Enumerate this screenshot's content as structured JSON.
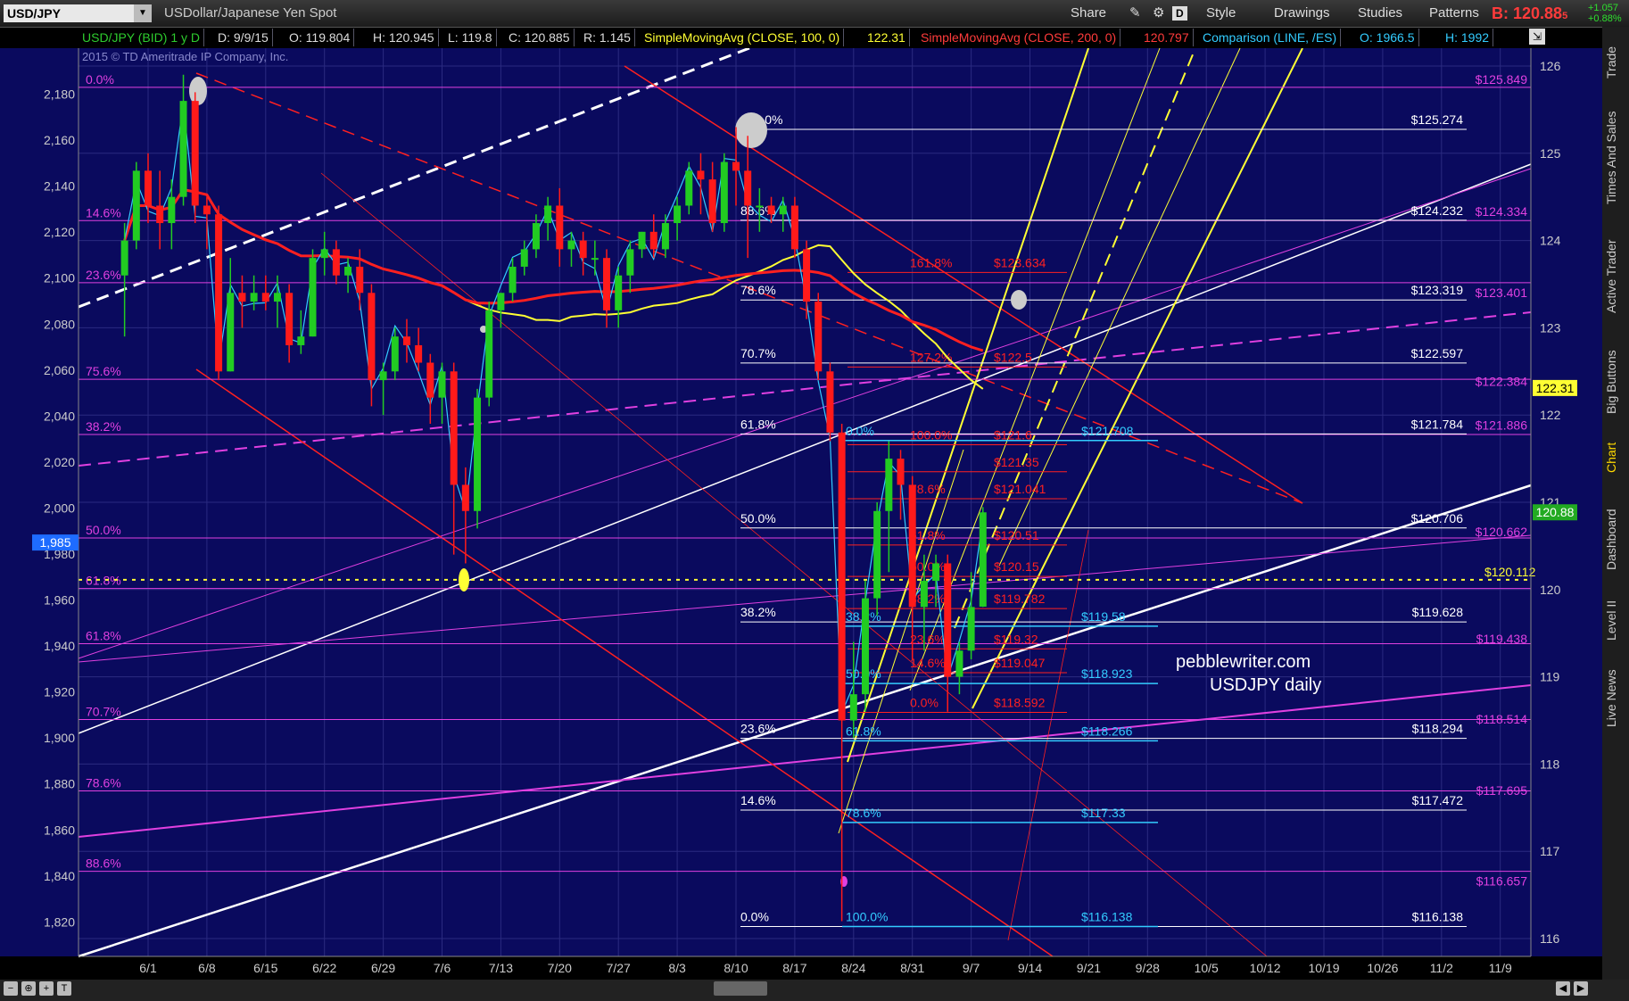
{
  "toolbar": {
    "symbol": "USD/JPY",
    "description": "USDollar/Japanese Yen Spot",
    "share": "Share",
    "style": "Style",
    "drawings": "Drawings",
    "studies": "Studies",
    "patterns": "Patterns",
    "d_box": "D",
    "bid": "B: 120.88",
    "bid_sub": "5",
    "change_up": "+1.057",
    "change_pct": "+0.88%"
  },
  "info_bar": {
    "symbol": "USD/JPY (BID) 1 y D",
    "date": "D: 9/9/15",
    "open": "O: 119.804",
    "high": "H: 120.945",
    "low": "L: 119.8",
    "close": "C: 120.885",
    "range": "R: 1.145",
    "sma100_label": "SimpleMovingAvg (CLOSE, 100, 0)",
    "sma100_value": "122.31",
    "sma200_label": "SimpleMovingAvg (CLOSE, 200, 0)",
    "sma200_value": "120.797",
    "comp_label": "Comparison (LINE, /ES)",
    "comp_open": "O: 1966.5",
    "comp_high": "H: 1992"
  },
  "side_tabs": [
    "Trade",
    "Times And Sales",
    "Active Trader",
    "Big Buttons",
    "Chart",
    "Dashboard",
    "Level II",
    "Live News"
  ],
  "copyright": "2015 © TD Ameritrade IP Company, Inc.",
  "watermark": [
    "pebblewriter.com",
    "USDJPY daily"
  ],
  "colors": {
    "background": "#0a0a5e",
    "grid": "#2a2a80",
    "magenta": "#e040e0",
    "red": "#ff2020",
    "yellow": "#ffff33",
    "cyan": "#33ccff",
    "white": "#ffffff",
    "up_candle": "#22cc22",
    "down_candle": "#ff1a1a"
  },
  "chart_data": {
    "type": "candlestick",
    "x_ticks": [
      "6/1",
      "6/8",
      "6/15",
      "6/22",
      "6/29",
      "7/6",
      "7/13",
      "7/20",
      "7/27",
      "8/3",
      "8/10",
      "8/17",
      "8/24",
      "8/31",
      "9/7",
      "9/14",
      "9/21",
      "9/28",
      "10/5",
      "10/12",
      "10/19",
      "10/26",
      "11/2",
      "11/9"
    ],
    "y_right": {
      "range": [
        116,
        126
      ],
      "ticks": [
        116,
        117,
        118,
        119,
        120,
        121,
        122,
        123,
        124,
        125,
        126
      ]
    },
    "y_left": {
      "range": [
        1805,
        2200
      ],
      "ticks": [
        1820,
        1840,
        1860,
        1880,
        1900,
        1920,
        1940,
        1960,
        1980,
        2000,
        2020,
        2040,
        2060,
        2080,
        2100,
        2120,
        2140,
        2160,
        2180
      ]
    },
    "price_tags": [
      {
        "label": "122.31",
        "value": 122.31,
        "style": "yellow"
      },
      {
        "label": "120.88",
        "value": 120.885,
        "style": "green"
      },
      {
        "label": "1,985",
        "value": 1985,
        "axis": "left",
        "style": "blue"
      }
    ],
    "candles": [
      {
        "date": "5/28",
        "o": 123.6,
        "h": 124.2,
        "l": 122.9,
        "c": 124.0
      },
      {
        "date": "6/1",
        "o": 124.0,
        "h": 124.9,
        "l": 123.9,
        "c": 124.8
      },
      {
        "date": "6/2",
        "o": 124.8,
        "h": 125.0,
        "l": 124.2,
        "c": 124.4
      },
      {
        "date": "6/3",
        "o": 124.4,
        "h": 124.8,
        "l": 123.9,
        "c": 124.2
      },
      {
        "date": "6/4",
        "o": 124.2,
        "h": 124.7,
        "l": 123.9,
        "c": 124.5
      },
      {
        "date": "6/5",
        "o": 124.5,
        "h": 125.9,
        "l": 124.4,
        "c": 125.6
      },
      {
        "date": "6/8",
        "o": 125.6,
        "h": 125.7,
        "l": 124.2,
        "c": 124.4
      },
      {
        "date": "6/9",
        "o": 124.4,
        "h": 124.5,
        "l": 123.9,
        "c": 124.3
      },
      {
        "date": "6/10",
        "o": 124.3,
        "h": 124.4,
        "l": 122.4,
        "c": 122.5
      },
      {
        "date": "6/11",
        "o": 122.5,
        "h": 123.8,
        "l": 122.5,
        "c": 123.4
      },
      {
        "date": "6/12",
        "o": 123.4,
        "h": 123.6,
        "l": 123.0,
        "c": 123.3
      },
      {
        "date": "6/15",
        "o": 123.3,
        "h": 123.6,
        "l": 123.2,
        "c": 123.4
      },
      {
        "date": "6/16",
        "o": 123.4,
        "h": 123.6,
        "l": 123.2,
        "c": 123.3
      },
      {
        "date": "6/17",
        "o": 123.3,
        "h": 123.6,
        "l": 123.0,
        "c": 123.4
      },
      {
        "date": "6/18",
        "o": 123.4,
        "h": 123.5,
        "l": 122.6,
        "c": 122.8
      },
      {
        "date": "6/19",
        "o": 122.8,
        "h": 123.2,
        "l": 122.7,
        "c": 122.9
      },
      {
        "date": "6/22",
        "o": 122.9,
        "h": 123.9,
        "l": 122.9,
        "c": 123.8
      },
      {
        "date": "6/23",
        "o": 123.8,
        "h": 124.1,
        "l": 123.6,
        "c": 123.9
      },
      {
        "date": "6/24",
        "o": 123.9,
        "h": 124.0,
        "l": 123.5,
        "c": 123.6
      },
      {
        "date": "6/25",
        "o": 123.6,
        "h": 123.8,
        "l": 123.4,
        "c": 123.7
      },
      {
        "date": "6/26",
        "o": 123.7,
        "h": 123.9,
        "l": 123.2,
        "c": 123.4
      },
      {
        "date": "6/29",
        "o": 123.4,
        "h": 123.5,
        "l": 122.1,
        "c": 122.4
      },
      {
        "date": "6/30",
        "o": 122.4,
        "h": 122.6,
        "l": 122.0,
        "c": 122.5
      },
      {
        "date": "7/1",
        "o": 122.5,
        "h": 123.0,
        "l": 122.4,
        "c": 122.9
      },
      {
        "date": "7/2",
        "o": 122.9,
        "h": 123.1,
        "l": 122.6,
        "c": 122.8
      },
      {
        "date": "7/3",
        "o": 122.8,
        "h": 123.0,
        "l": 122.5,
        "c": 122.6
      },
      {
        "date": "7/6",
        "o": 122.6,
        "h": 122.7,
        "l": 121.9,
        "c": 122.2
      },
      {
        "date": "7/7",
        "o": 122.2,
        "h": 122.6,
        "l": 121.9,
        "c": 122.5
      },
      {
        "date": "7/8",
        "o": 122.5,
        "h": 122.6,
        "l": 120.4,
        "c": 121.2
      },
      {
        "date": "7/9",
        "o": 121.2,
        "h": 121.4,
        "l": 120.3,
        "c": 120.9
      },
      {
        "date": "7/10",
        "o": 120.9,
        "h": 122.3,
        "l": 120.7,
        "c": 122.2
      },
      {
        "date": "7/13",
        "o": 122.2,
        "h": 123.3,
        "l": 122.1,
        "c": 123.2
      },
      {
        "date": "7/14",
        "o": 123.2,
        "h": 123.4,
        "l": 123.0,
        "c": 123.4
      },
      {
        "date": "7/15",
        "o": 123.4,
        "h": 123.8,
        "l": 123.3,
        "c": 123.7
      },
      {
        "date": "7/16",
        "o": 123.7,
        "h": 124.0,
        "l": 123.6,
        "c": 123.9
      },
      {
        "date": "7/17",
        "o": 123.9,
        "h": 124.3,
        "l": 123.8,
        "c": 124.2
      },
      {
        "date": "7/20",
        "o": 124.2,
        "h": 124.5,
        "l": 124.0,
        "c": 124.4
      },
      {
        "date": "7/21",
        "o": 124.4,
        "h": 124.6,
        "l": 123.7,
        "c": 123.9
      },
      {
        "date": "7/22",
        "o": 123.9,
        "h": 124.1,
        "l": 123.7,
        "c": 124.0
      },
      {
        "date": "7/23",
        "o": 124.0,
        "h": 124.1,
        "l": 123.6,
        "c": 123.8
      },
      {
        "date": "7/24",
        "o": 123.8,
        "h": 124.0,
        "l": 123.6,
        "c": 123.8
      },
      {
        "date": "7/27",
        "o": 123.8,
        "h": 123.9,
        "l": 123.0,
        "c": 123.2
      },
      {
        "date": "7/28",
        "o": 123.2,
        "h": 123.7,
        "l": 123.0,
        "c": 123.6
      },
      {
        "date": "7/29",
        "o": 123.6,
        "h": 124.0,
        "l": 123.4,
        "c": 123.9
      },
      {
        "date": "7/30",
        "o": 123.9,
        "h": 124.1,
        "l": 123.8,
        "c": 124.1
      },
      {
        "date": "7/31",
        "o": 124.1,
        "h": 124.3,
        "l": 123.8,
        "c": 123.9
      },
      {
        "date": "8/3",
        "o": 123.9,
        "h": 124.3,
        "l": 123.8,
        "c": 124.2
      },
      {
        "date": "8/4",
        "o": 124.2,
        "h": 124.5,
        "l": 124.0,
        "c": 124.4
      },
      {
        "date": "8/5",
        "o": 124.4,
        "h": 124.9,
        "l": 124.3,
        "c": 124.8
      },
      {
        "date": "8/6",
        "o": 124.8,
        "h": 125.0,
        "l": 124.3,
        "c": 124.7
      },
      {
        "date": "8/7",
        "o": 124.7,
        "h": 124.9,
        "l": 124.1,
        "c": 124.2
      },
      {
        "date": "8/10",
        "o": 124.2,
        "h": 125.0,
        "l": 124.1,
        "c": 124.9
      },
      {
        "date": "8/11",
        "o": 124.9,
        "h": 125.3,
        "l": 124.4,
        "c": 124.8
      },
      {
        "date": "8/12",
        "o": 124.8,
        "h": 125.2,
        "l": 123.8,
        "c": 124.4
      },
      {
        "date": "8/13",
        "o": 124.4,
        "h": 124.6,
        "l": 124.1,
        "c": 124.4
      },
      {
        "date": "8/14",
        "o": 124.4,
        "h": 124.5,
        "l": 124.2,
        "c": 124.3
      },
      {
        "date": "8/17",
        "o": 124.3,
        "h": 124.5,
        "l": 124.1,
        "c": 124.4
      },
      {
        "date": "8/18",
        "o": 124.4,
        "h": 124.5,
        "l": 123.8,
        "c": 123.9
      },
      {
        "date": "8/19",
        "o": 123.9,
        "h": 124.0,
        "l": 123.1,
        "c": 123.3
      },
      {
        "date": "8/20",
        "o": 123.3,
        "h": 123.4,
        "l": 122.4,
        "c": 122.5
      },
      {
        "date": "8/21",
        "o": 122.5,
        "h": 122.6,
        "l": 121.7,
        "c": 121.8
      },
      {
        "date": "8/24",
        "o": 121.8,
        "h": 121.9,
        "l": 116.2,
        "c": 118.5
      },
      {
        "date": "8/25",
        "o": 118.5,
        "h": 119.4,
        "l": 118.3,
        "c": 118.8
      },
      {
        "date": "8/26",
        "o": 118.8,
        "h": 120.1,
        "l": 118.6,
        "c": 119.9
      },
      {
        "date": "8/27",
        "o": 119.9,
        "h": 121.0,
        "l": 119.7,
        "c": 120.9
      },
      {
        "date": "8/28",
        "o": 120.9,
        "h": 121.7,
        "l": 120.2,
        "c": 121.5
      },
      {
        "date": "8/31",
        "o": 121.5,
        "h": 121.6,
        "l": 120.8,
        "c": 121.2
      },
      {
        "date": "9/1",
        "o": 121.2,
        "h": 121.3,
        "l": 119.2,
        "c": 119.8
      },
      {
        "date": "9/2",
        "o": 119.8,
        "h": 120.4,
        "l": 119.3,
        "c": 120.1
      },
      {
        "date": "9/3",
        "o": 120.1,
        "h": 120.4,
        "l": 119.8,
        "c": 120.3
      },
      {
        "date": "9/4",
        "o": 120.3,
        "h": 120.4,
        "l": 118.6,
        "c": 119.0
      },
      {
        "date": "9/7",
        "o": 119.0,
        "h": 119.4,
        "l": 118.8,
        "c": 119.3
      },
      {
        "date": "9/8",
        "o": 119.3,
        "h": 120.2,
        "l": 119.2,
        "c": 119.8
      },
      {
        "date": "9/9",
        "o": 119.804,
        "h": 120.945,
        "l": 119.8,
        "c": 120.885
      }
    ],
    "left_fib_levels": [
      {
        "label": "0.0%",
        "value": 2183
      },
      {
        "label": "14.6%",
        "value": 2125
      },
      {
        "label": "23.6%",
        "value": 2098
      },
      {
        "label": "75.6%",
        "value": 2056
      },
      {
        "label": "38.2%",
        "value": 2032
      },
      {
        "label": "50.0%",
        "value": 1987
      },
      {
        "label": "61.8%",
        "value": 1965
      },
      {
        "label": "61.8%",
        "value": 1941
      },
      {
        "label": "70.7%",
        "value": 1908
      },
      {
        "label": "78.6%",
        "value": 1877
      },
      {
        "label": "88.6%",
        "value": 1842
      }
    ],
    "white_fib_levels": [
      {
        "pct": "100.0%",
        "price": "$125.274",
        "value": 125.274
      },
      {
        "pct": "88.6%",
        "price": "$124.232",
        "value": 124.232
      },
      {
        "pct": "78.6%",
        "price": "$123.319",
        "value": 123.319
      },
      {
        "pct": "70.7%",
        "price": "$122.597",
        "value": 122.597
      },
      {
        "pct": "61.8%",
        "price": "$121.784",
        "value": 121.784
      },
      {
        "pct": "50.0%",
        "price": "$120.706",
        "value": 120.706
      },
      {
        "pct": "38.2%",
        "price": "$119.628",
        "value": 119.628
      },
      {
        "pct": "23.6%",
        "price": "$118.294",
        "value": 118.294
      },
      {
        "pct": "14.6%",
        "price": "$117.472",
        "value": 117.472
      },
      {
        "pct": "0.0%",
        "price": "$116.138",
        "value": 116.138
      }
    ],
    "magenta_right_levels": [
      {
        "price": "$125.849",
        "value": 125.849
      },
      {
        "price": "$124.334",
        "value": 124.334
      },
      {
        "price": "$123.401",
        "value": 123.401
      },
      {
        "price": "$122.384",
        "value": 122.384
      },
      {
        "price": "$121.886",
        "value": 121.886
      },
      {
        "price": "$120.662",
        "value": 120.662
      },
      {
        "price": "$119.438",
        "value": 119.438
      },
      {
        "price": "$118.514",
        "value": 118.514
      },
      {
        "price": "$117.695",
        "value": 117.695
      },
      {
        "price": "$116.657",
        "value": 116.657
      }
    ],
    "yellow_level": {
      "price": "$120.112",
      "value": 120.112
    },
    "red_fib_levels": [
      {
        "pct": "161.8%",
        "price": "$123.634",
        "value": 123.634
      },
      {
        "pct": "127.2%",
        "price": "$122.5",
        "value": 122.55
      },
      {
        "pct": "100.0%",
        "price": "$121.6",
        "value": 121.66
      },
      {
        "pct": "",
        "price": "$121.35",
        "value": 121.35
      },
      {
        "pct": "78.6%",
        "price": "$121.041",
        "value": 121.041
      },
      {
        "pct": "61.8%",
        "price": "$120.51",
        "value": 120.51
      },
      {
        "pct": "50.0%",
        "price": "$120.15",
        "value": 120.15
      },
      {
        "pct": "38.2%",
        "price": "$119.782",
        "value": 119.782
      },
      {
        "pct": "23.6%",
        "price": "$119.32",
        "value": 119.32
      },
      {
        "pct": "14.6%",
        "price": "$119.047",
        "value": 119.047
      },
      {
        "pct": "0.0%",
        "price": "$118.592",
        "value": 118.592
      }
    ],
    "cyan_fib_levels": [
      {
        "pct": "0.0%",
        "price": "$121.708",
        "value": 121.708
      },
      {
        "pct": "38.2%",
        "price": "$119.58",
        "value": 119.58
      },
      {
        "pct": "50.0%",
        "price": "$118.923",
        "value": 118.923
      },
      {
        "pct": "61.8%",
        "price": "$118.266",
        "value": 118.266
      },
      {
        "pct": "78.6%",
        "price": "$117.33",
        "value": 117.33
      },
      {
        "pct": "100.0%",
        "price": "$116.138",
        "value": 116.138
      }
    ]
  }
}
